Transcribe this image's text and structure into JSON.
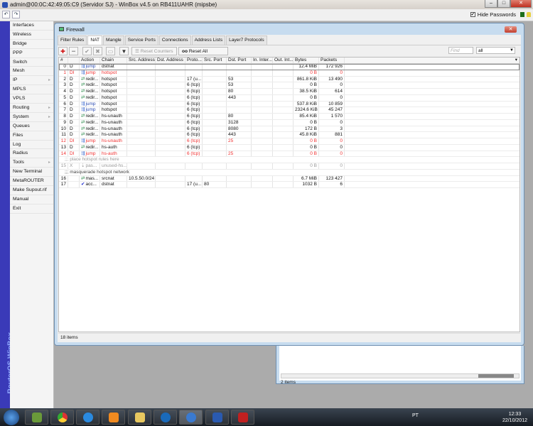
{
  "window": {
    "title": "admin@00:0C:42:49:05:C9 (Servidor SJ) - WinBox v4.5 on RB411UAHR (mipsbe)",
    "minimize": "–",
    "maximize": "□",
    "close": "✕"
  },
  "topbar": {
    "undo": "↶",
    "redo": "↷",
    "hide_passwords": "Hide Passwords",
    "hide_passwords_checked": "✔"
  },
  "sidebar": {
    "brand": "RouterOS WinBox",
    "items": [
      {
        "label": "Interfaces"
      },
      {
        "label": "Wireless"
      },
      {
        "label": "Bridge"
      },
      {
        "label": "PPP"
      },
      {
        "label": "Switch"
      },
      {
        "label": "Mesh"
      },
      {
        "label": "IP",
        "sub": "▸"
      },
      {
        "label": "MPLS"
      },
      {
        "label": "VPLS"
      },
      {
        "label": "Routing",
        "sub": "▸"
      },
      {
        "label": "System",
        "sub": "▸"
      },
      {
        "label": "Queues"
      },
      {
        "label": "Files"
      },
      {
        "label": "Log"
      },
      {
        "label": "Radius"
      },
      {
        "label": "Tools",
        "sub": "▸"
      },
      {
        "label": "New Terminal"
      },
      {
        "label": "MetaROUTER"
      },
      {
        "label": "Make Supout.rif"
      },
      {
        "label": "Manual"
      },
      {
        "label": "Exit"
      }
    ]
  },
  "firewall": {
    "title": "Firewall",
    "close": "✕",
    "tabs": [
      "Filter Rules",
      "NAT",
      "Mangle",
      "Service Ports",
      "Connections",
      "Address Lists",
      "Layer7 Protocols"
    ],
    "toolbar": {
      "add": "✚",
      "remove": "━",
      "enable": "✔",
      "disable": "✖",
      "comment": "▭",
      "filter": "▼",
      "reset_counters": "Reset Counters",
      "reset_all_counters": "Reset All Counters",
      "reset_all_prefix": "oo",
      "find_placeholder": "Find",
      "filter_value": "all",
      "dropdown": "▼"
    },
    "columns": [
      "#",
      "",
      "Action",
      "Chain",
      "Src. Address",
      "Dst. Address",
      "Proto...",
      "Src. Port",
      "Dst. Port",
      "In. Inter...",
      "Out. Int...",
      "Bytes",
      "Packets"
    ],
    "rows": [
      {
        "type": "rule",
        "num": "0",
        "flags": "D",
        "action": "jump",
        "chain": "dstnat",
        "src": "",
        "dst": "",
        "proto": "",
        "sport": "",
        "dport": "",
        "in": "",
        "out": "",
        "bytes": "12.4 MiB",
        "packets": "172 926",
        "state": "normal",
        "icon": "jump"
      },
      {
        "type": "rule",
        "num": "1",
        "flags": "DI",
        "action": "jump",
        "chain": "hotspot",
        "src": "",
        "dst": "",
        "proto": "",
        "sport": "",
        "dport": "",
        "in": "",
        "out": "",
        "bytes": "0 B",
        "packets": "0",
        "state": "red",
        "icon": "jump"
      },
      {
        "type": "rule",
        "num": "2",
        "flags": "D",
        "action": "redir...",
        "chain": "hotspot",
        "src": "",
        "dst": "",
        "proto": "17 (u...",
        "sport": "",
        "dport": "53",
        "in": "",
        "out": "",
        "bytes": "861.8 KiB",
        "packets": "13 490",
        "state": "normal",
        "icon": "redirect"
      },
      {
        "type": "rule",
        "num": "3",
        "flags": "D",
        "action": "redir...",
        "chain": "hotspot",
        "src": "",
        "dst": "",
        "proto": "6 (tcp)",
        "sport": "",
        "dport": "53",
        "in": "",
        "out": "",
        "bytes": "0 B",
        "packets": "0",
        "state": "normal",
        "icon": "redirect"
      },
      {
        "type": "rule",
        "num": "4",
        "flags": "D",
        "action": "redir...",
        "chain": "hotspot",
        "src": "",
        "dst": "",
        "proto": "6 (tcp)",
        "sport": "",
        "dport": "80",
        "in": "",
        "out": "",
        "bytes": "38.5 KiB",
        "packets": "614",
        "state": "normal",
        "icon": "redirect"
      },
      {
        "type": "rule",
        "num": "5",
        "flags": "D",
        "action": "redir...",
        "chain": "hotspot",
        "src": "",
        "dst": "",
        "proto": "6 (tcp)",
        "sport": "",
        "dport": "443",
        "in": "",
        "out": "",
        "bytes": "0 B",
        "packets": "0",
        "state": "normal",
        "icon": "redirect"
      },
      {
        "type": "rule",
        "num": "6",
        "flags": "D",
        "action": "jump",
        "chain": "hotspot",
        "src": "",
        "dst": "",
        "proto": "6 (tcp)",
        "sport": "",
        "dport": "",
        "in": "",
        "out": "",
        "bytes": "537.8 KiB",
        "packets": "10 859",
        "state": "normal",
        "icon": "jump"
      },
      {
        "type": "rule",
        "num": "7",
        "flags": "D",
        "action": "jump",
        "chain": "hotspot",
        "src": "",
        "dst": "",
        "proto": "6 (tcp)",
        "sport": "",
        "dport": "",
        "in": "",
        "out": "",
        "bytes": "2324.6 KiB",
        "packets": "45 247",
        "state": "normal",
        "icon": "jump"
      },
      {
        "type": "rule",
        "num": "8",
        "flags": "D",
        "action": "redir...",
        "chain": "hs-unauth",
        "src": "",
        "dst": "",
        "proto": "6 (tcp)",
        "sport": "",
        "dport": "80",
        "in": "",
        "out": "",
        "bytes": "85.4 KiB",
        "packets": "1 570",
        "state": "normal",
        "icon": "redirect"
      },
      {
        "type": "rule",
        "num": "9",
        "flags": "D",
        "action": "redir...",
        "chain": "hs-unauth",
        "src": "",
        "dst": "",
        "proto": "6 (tcp)",
        "sport": "",
        "dport": "3128",
        "in": "",
        "out": "",
        "bytes": "0 B",
        "packets": "0",
        "state": "normal",
        "icon": "redirect"
      },
      {
        "type": "rule",
        "num": "10",
        "flags": "D",
        "action": "redir...",
        "chain": "hs-unauth",
        "src": "",
        "dst": "",
        "proto": "6 (tcp)",
        "sport": "",
        "dport": "8080",
        "in": "",
        "out": "",
        "bytes": "172 B",
        "packets": "3",
        "state": "normal",
        "icon": "redirect"
      },
      {
        "type": "rule",
        "num": "11",
        "flags": "D",
        "action": "redir...",
        "chain": "hs-unauth",
        "src": "",
        "dst": "",
        "proto": "6 (tcp)",
        "sport": "",
        "dport": "443",
        "in": "",
        "out": "",
        "bytes": "45.8 KiB",
        "packets": "881",
        "state": "normal",
        "icon": "redirect"
      },
      {
        "type": "rule",
        "num": "12",
        "flags": "DI",
        "action": "jump",
        "chain": "hs-unauth",
        "src": "",
        "dst": "",
        "proto": "6 (tcp)",
        "sport": "",
        "dport": "25",
        "in": "",
        "out": "",
        "bytes": "0 B",
        "packets": "0",
        "state": "red",
        "icon": "jump"
      },
      {
        "type": "rule",
        "num": "13",
        "flags": "D",
        "action": "redir...",
        "chain": "hs-auth",
        "src": "",
        "dst": "",
        "proto": "6 (tcp)",
        "sport": "",
        "dport": "",
        "in": "",
        "out": "",
        "bytes": "0 B",
        "packets": "0",
        "state": "normal",
        "icon": "redirect"
      },
      {
        "type": "rule",
        "num": "14",
        "flags": "DI",
        "action": "jump",
        "chain": "hs-auth",
        "src": "",
        "dst": "",
        "proto": "6 (tcp)",
        "sport": "",
        "dport": "25",
        "in": "",
        "out": "",
        "bytes": "0 B",
        "packets": "0",
        "state": "red",
        "icon": "jump"
      },
      {
        "type": "comment",
        "text": ";;; place hotspot rules here",
        "state": "gray"
      },
      {
        "type": "rule",
        "num": "15",
        "flags": "X",
        "action": "pas...",
        "chain": "unused-hs...",
        "src": "",
        "dst": "",
        "proto": "",
        "sport": "",
        "dport": "",
        "in": "",
        "out": "",
        "bytes": "0 B",
        "packets": "0",
        "state": "gray",
        "icon": "passthrough"
      },
      {
        "type": "comment",
        "text": ";;; masquerade hotspot network",
        "state": "normal"
      },
      {
        "type": "rule",
        "num": "16",
        "flags": "",
        "action": "mas...",
        "chain": "srcnat",
        "src": "10.5.50.0/24",
        "dst": "",
        "proto": "",
        "sport": "",
        "dport": "",
        "in": "",
        "out": "",
        "bytes": "6.7 MiB",
        "packets": "123 427",
        "state": "normal",
        "icon": "redirect"
      },
      {
        "type": "rule",
        "num": "17",
        "flags": "",
        "action": "acc...",
        "chain": "dstnat",
        "src": "",
        "dst": "",
        "proto": "17 (u...",
        "sport": "80",
        "dport": "",
        "in": "",
        "out": "",
        "bytes": "1032 B",
        "packets": "6",
        "state": "normal",
        "icon": "accept"
      }
    ],
    "status": "18 items"
  },
  "second_window": {
    "status": "2 items"
  },
  "taskbar": {
    "language": "PT",
    "time": "12:33",
    "date": "22/10/2012"
  },
  "colors": {
    "disabled_red": "#f03030",
    "sidebar_blue": "#3a3ab8"
  }
}
